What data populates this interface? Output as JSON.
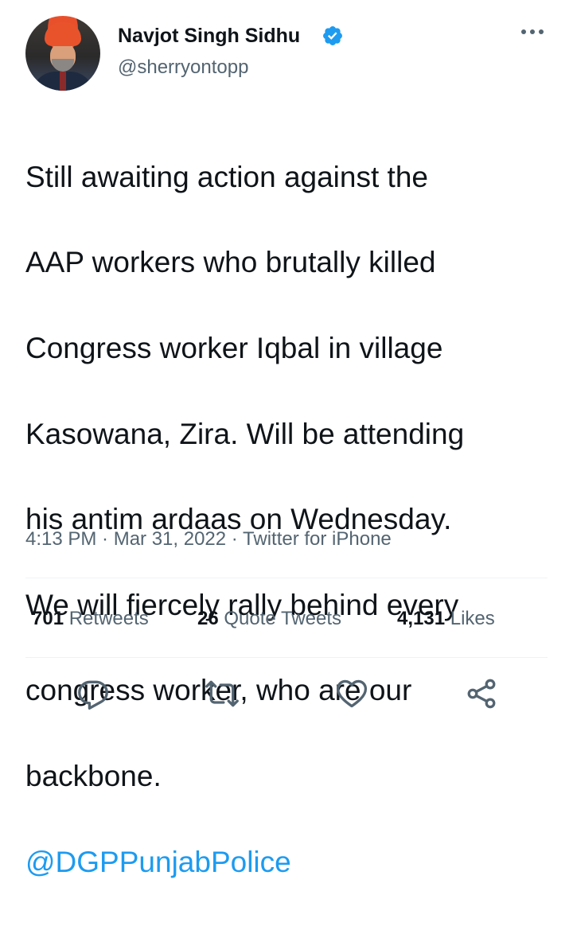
{
  "author": {
    "name": "Navjot Singh Sidhu",
    "handle": "@sherryontopp",
    "verified": true
  },
  "tweet": {
    "lines": [
      "Still awaiting action against the",
      "AAP workers who brutally killed",
      "Congress worker Iqbal in village",
      "Kasowana, Zira. Will be attending",
      "his antim ardaas on Wednesday.",
      "We will fiercely rally behind every",
      "congress worker, who are our",
      "backbone."
    ],
    "mention": "@DGPPunjabPolice"
  },
  "meta": {
    "text": "4:13 PM · Mar 31, 2022 · Twitter for iPhone"
  },
  "stats": {
    "retweets_count": "701",
    "retweets_label": "Retweets",
    "quotes_count": "26",
    "quotes_label": "Quote Tweets",
    "likes_count": "4,131",
    "likes_label": "Likes"
  },
  "actions": {
    "icons": [
      "reply-icon",
      "retweet-icon",
      "like-icon",
      "share-icon"
    ]
  },
  "colors": {
    "text": "#0f1419",
    "secondary": "#536471",
    "accent": "#1d9bf0",
    "divider": "#eff3f4"
  }
}
